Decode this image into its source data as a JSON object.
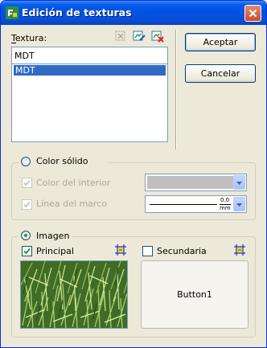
{
  "window": {
    "title": "Edición de texturas"
  },
  "textura": {
    "label": "Textura:",
    "input_value": "MDT",
    "list_items": [
      "MDT"
    ],
    "selected_index": 0,
    "toolbar_icons": [
      "texture-options-icon",
      "texture-edit-icon",
      "texture-delete-icon"
    ]
  },
  "buttons": {
    "accept": "Aceptar",
    "cancel": "Cancelar"
  },
  "color_solido": {
    "label": "Color sólido",
    "selected": false,
    "interior_label": "Color del interior",
    "interior_checked": true,
    "interior_color": "#c0c0c0",
    "marco_label": "Línea del marco",
    "marco_checked": true,
    "line_width_value": "0.0",
    "line_width_unit": "mm"
  },
  "imagen": {
    "label": "Imagen",
    "selected": true,
    "principal_label": "Principal",
    "principal_checked": true,
    "secundaria_label": "Secundaria",
    "secundaria_checked": false,
    "secondary_button_label": "Button1"
  }
}
